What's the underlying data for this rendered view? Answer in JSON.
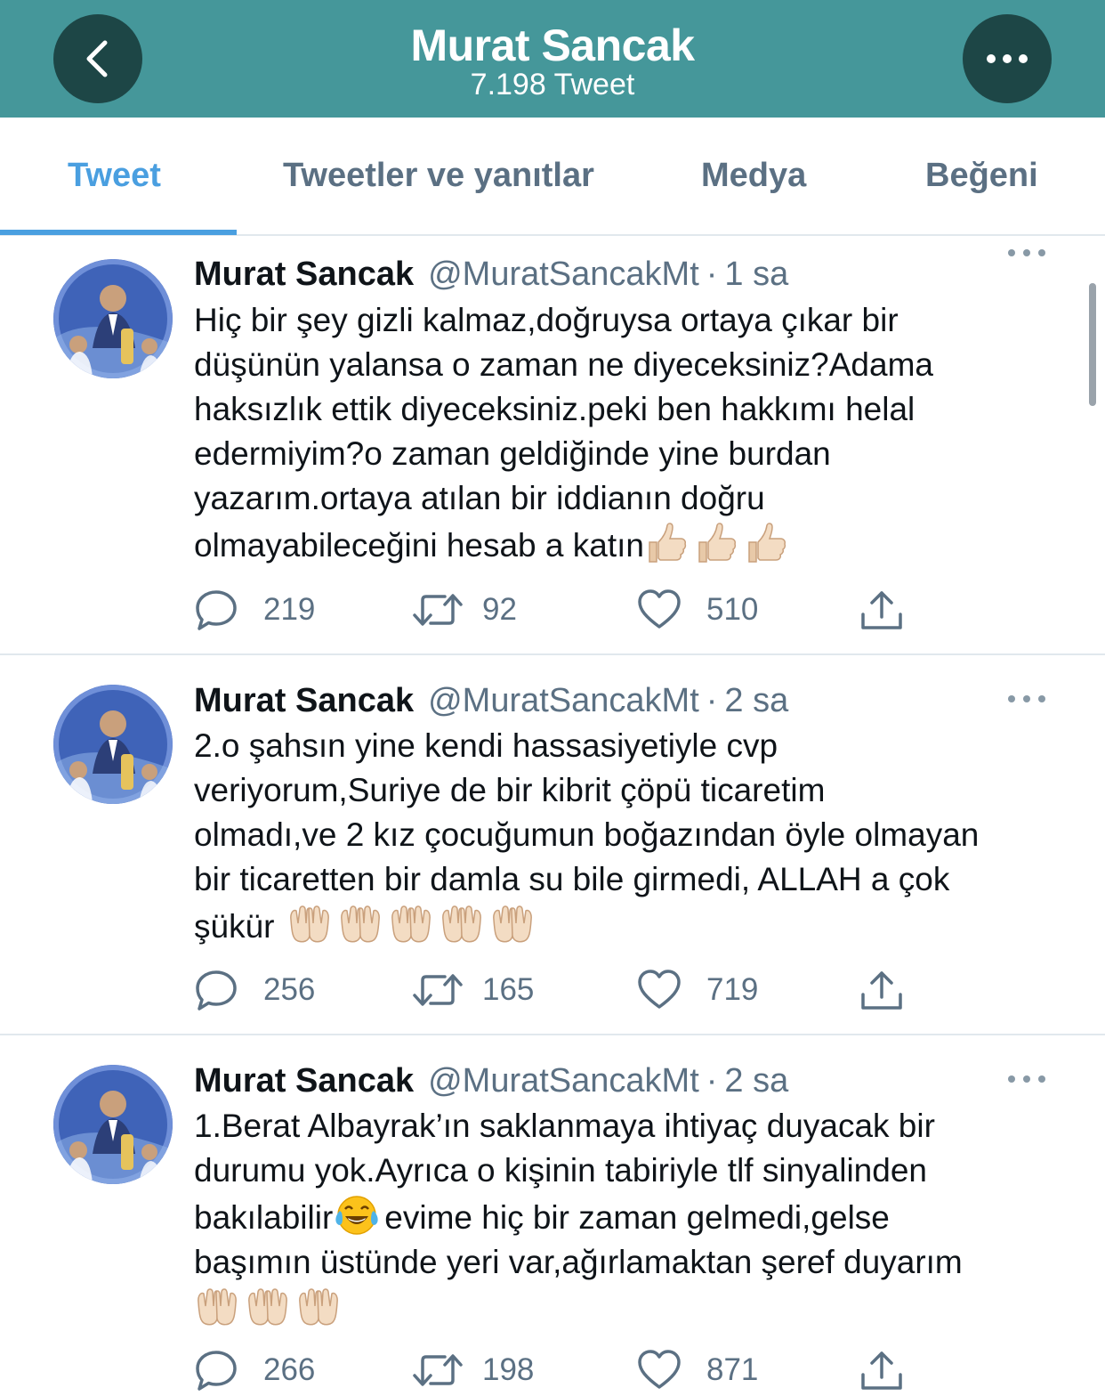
{
  "header": {
    "title": "Murat Sancak",
    "subtitle": "7.198 Tweet",
    "back_icon": "chevron-left-icon",
    "more_icon": "more-horizontal-icon",
    "bg_color": "#45979a"
  },
  "tabs": [
    {
      "label": "Tweet",
      "active": true
    },
    {
      "label": "Tweetler ve yanıtlar",
      "active": false
    },
    {
      "label": "Medya",
      "active": false
    },
    {
      "label": "Beğeni",
      "active": false
    }
  ],
  "accent_color": "#4a9fe0",
  "tweets": [
    {
      "name": "Murat Sancak",
      "handle": "@MuratSancakMt",
      "time": "1 sa",
      "lines": [
        "Hiç bir şey gizli kalmaz,doğruysa ortaya çıkar bir",
        "düşünün yalansa o zaman ne diyeceksiniz?Adama",
        "haksızlık ettik diyeceksiniz.peki ben hakkımı helal",
        "edermiyim?o zaman geldiğinde yine burdan",
        "yazarım.ortaya atılan bir iddianın doğru",
        "olmayabileceğini hesab a katın"
      ],
      "emojis": [
        "thumbs-up",
        "thumbs-up",
        "thumbs-up"
      ],
      "replies": "219",
      "retweets": "92",
      "likes": "510"
    },
    {
      "name": "Murat Sancak",
      "handle": "@MuratSancakMt",
      "time": "2 sa",
      "lines": [
        "2.o şahsın yine kendi hassasiyetiyle cvp",
        "veriyorum,Suriye de bir kibrit çöpü ticaretim",
        "olmadı,ve 2 kız çocuğumun boğazından öyle olmayan",
        "bir ticaretten bir damla su bile girmedi, ALLAH a çok",
        "şükür"
      ],
      "emojis": [
        "palms-up",
        "palms-up",
        "palms-up",
        "palms-up",
        "palms-up"
      ],
      "replies": "256",
      "retweets": "165",
      "likes": "719"
    },
    {
      "name": "Murat Sancak",
      "handle": "@MuratSancakMt",
      "time": "2 sa",
      "lines": [
        "1.Berat Albayrak’ın saklanmaya ihtiyaç duyacak bir",
        "durumu yok.Ayrıca o kişinin tabiriyle tlf sinyalinden",
        "bakılabilir",
        "evime hiç bir zaman gelmedi,gelse",
        "başımın üstünde yeri var,ağırlamaktan şeref duyarım"
      ],
      "emojis": [
        "tears-of-joy",
        "palms-up",
        "palms-up",
        "palms-up"
      ],
      "replies": "266",
      "retweets": "198",
      "likes": "871"
    }
  ]
}
